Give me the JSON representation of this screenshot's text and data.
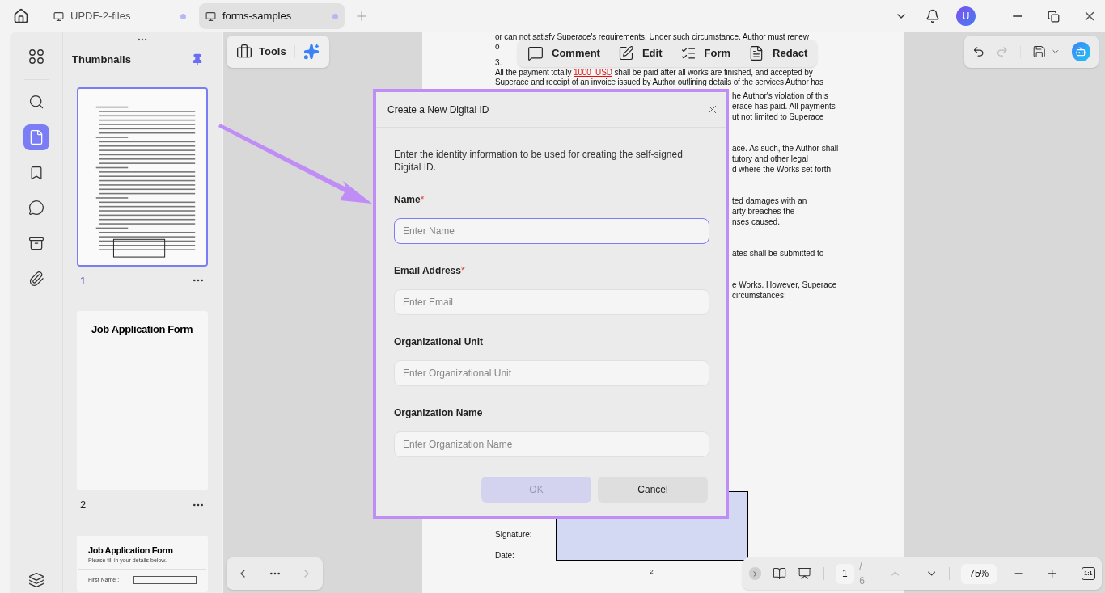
{
  "tabs": [
    {
      "label": "UPDF-2-files",
      "selected": false
    },
    {
      "label": "forms-samples",
      "selected": true
    }
  ],
  "user": {
    "initial": "U"
  },
  "rail": [
    {
      "kind": "apps",
      "selected": false
    },
    {
      "kind": "search",
      "selected": false
    },
    {
      "kind": "pages",
      "selected": true
    },
    {
      "kind": "bookmark",
      "selected": false
    },
    {
      "kind": "comment",
      "selected": false
    },
    {
      "kind": "form",
      "selected": false
    },
    {
      "kind": "attachment",
      "selected": false
    },
    {
      "kind": "layers",
      "selected": false
    }
  ],
  "thumbnails": {
    "title": "Thumbnails",
    "pages": [
      {
        "kind": "contract",
        "number": "1",
        "selected": true
      },
      {
        "kind": "title_only",
        "number": "2",
        "title": "Job Application Form",
        "selected": false
      },
      {
        "kind": "form_fields",
        "title": "Job Application Form",
        "subtitle": "Please fill in your details below.",
        "field_label": "First Name :",
        "selected": false
      }
    ]
  },
  "tools": {
    "label": "Tools"
  },
  "annotation_toolbar": [
    {
      "kind": "comment",
      "label": "Comment"
    },
    {
      "kind": "edit",
      "label": "Edit"
    },
    {
      "kind": "form",
      "label": "Form"
    },
    {
      "kind": "redact",
      "label": "Redact"
    }
  ],
  "document": {
    "top_lines": [
      "or can not satisfy Superace's requirements. Under such circumstance, Author must renew",
      "o"
    ],
    "clause_number": "3.",
    "payment": {
      "before": "All the payment totally ",
      "amount": "1000_USD",
      "after": " shall be paid after all works are finished, and accepted by"
    },
    "line_after": "Superace and receipt of an invoice issued by Author outlining details of the services Author has",
    "fragments": [
      [
        "he Author's violation of this",
        "erace has paid. All payments",
        "ut not limited to Superace"
      ],
      [
        "ace. As such, the Author shall",
        "tutory and other legal",
        "d where the Works set forth"
      ],
      [
        "ted damages with an",
        "arty breaches the",
        "nses caused."
      ],
      [
        "ates shall be submitted to"
      ],
      [
        "e Works. However, Superace",
        "circumstances:"
      ]
    ],
    "signature_labels": [
      "Signature:",
      "Date:"
    ],
    "page_number": "2"
  },
  "dialog": {
    "title": "Create a New Digital ID",
    "description": "Enter the identity information to be used for creating the self-signed Digital ID.",
    "fields": [
      {
        "label": "Name",
        "required_mark": "*",
        "placeholder": "Enter Name",
        "focused": true
      },
      {
        "label": "Email Address",
        "required_mark": "*",
        "placeholder": "Enter Email",
        "focused": false
      },
      {
        "label": "Organizational Unit",
        "placeholder": "Enter Organizational Unit",
        "focused": false
      },
      {
        "label": "Organization Name",
        "placeholder": "Enter Organization Name",
        "focused": false
      }
    ],
    "buttons": [
      {
        "label": "OK",
        "disabled": true
      },
      {
        "label": "Cancel",
        "disabled": false
      }
    ]
  },
  "page_nav": {
    "current": "1",
    "total": "/ 6",
    "zoom": "75%",
    "actual_size": "1:1"
  }
}
